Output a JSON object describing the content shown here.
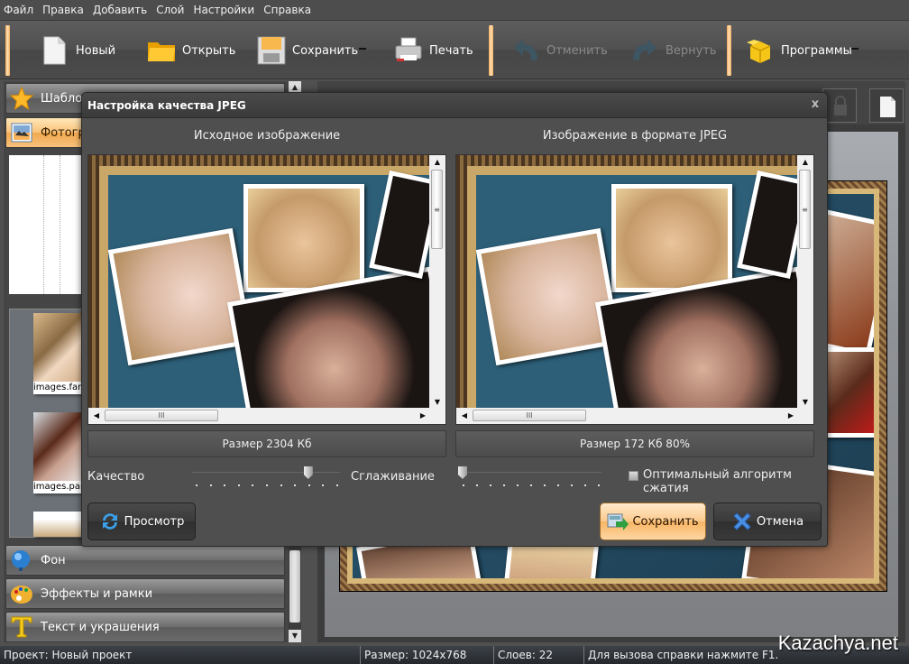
{
  "menu": [
    "Файл",
    "Правка",
    "Добавить",
    "Слой",
    "Настройки",
    "Справка"
  ],
  "toolbar": {
    "new_label": "Новый",
    "open_label": "Открыть",
    "save_label": "Сохранить",
    "print_label": "Печать",
    "undo_label": "Отменить",
    "redo_label": "Вернуть",
    "programs_label": "Программы"
  },
  "left_panel": {
    "items": [
      {
        "label": "Шаблоны",
        "icon": "star-icon"
      },
      {
        "label": "Фотографии",
        "icon": "photo-icon",
        "active": true
      },
      {
        "label": "Фон",
        "icon": "globe-icon"
      },
      {
        "label": "Эффекты и рамки",
        "icon": "palette-icon"
      },
      {
        "label": "Текст и украшения",
        "icon": "text-t-icon"
      }
    ],
    "thumbnails": [
      {
        "caption": "images.fan"
      },
      {
        "caption": "images.par"
      },
      {
        "caption": ""
      }
    ]
  },
  "dialog": {
    "title": "Настройка качества JPEG",
    "close_label": "x",
    "source_title": "Исходное изображение",
    "jpeg_title": "Изображение в формате JPEG",
    "source_size": "Размер 2304 Кб",
    "jpeg_size": "Размер 172 Кб 80%",
    "quality_label": "Качество",
    "quality_value_percent": 80,
    "smoothing_label": "Сглаживание",
    "smoothing_value_percent": 0,
    "optimal_label": "Оптимальный алгоритм сжатия",
    "optimal_checked": false,
    "preview_button": "Просмотр",
    "save_button": "Сохранить",
    "cancel_button": "Отмена",
    "scroll_grip": "III"
  },
  "statusbar": {
    "project": "Проект: Новый проект",
    "size": "Размер: 1024x768",
    "layers": "Слоев: 22",
    "help": "Для вызова справки нажмите F1."
  },
  "watermark": "Kazachya.net",
  "colors": {
    "accent_orange": "#f8b463",
    "separator": "#f0a95a",
    "panel_dark": "#4f4f4f"
  }
}
